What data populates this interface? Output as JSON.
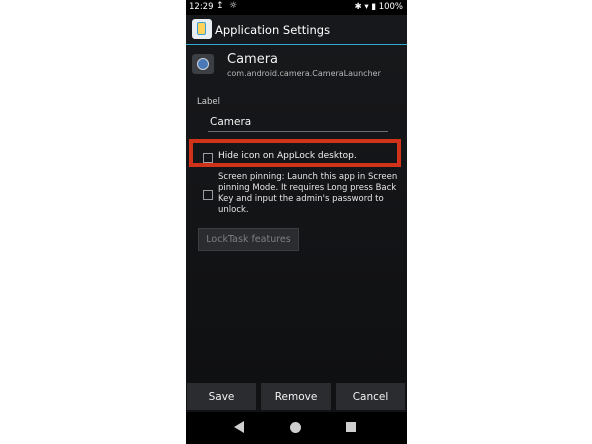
{
  "status_bar": {
    "time": "12:29",
    "upload_icon": "↥",
    "sun_icon": "☼",
    "right": "✱ ▾ ▮ 100%"
  },
  "titlebar": {
    "title": "Application Settings"
  },
  "app": {
    "name": "Camera",
    "package": "com.android.camera.CameraLauncher"
  },
  "label_field": {
    "label": "Label",
    "value": "Camera"
  },
  "options": {
    "hide_icon": {
      "label": "Hide icon on AppLock desktop.",
      "checked": false
    },
    "screen_pinning": {
      "label": "Screen pinning: Launch this app in Screen pinning Mode. It requires Long press Back Key and input the admin's password to unlock.",
      "checked": false
    }
  },
  "locktask_button": "LockTask features",
  "buttons": {
    "save": "Save",
    "remove": "Remove",
    "cancel": "Cancel"
  },
  "colors": {
    "highlight": "#d03319",
    "accent_line": "#2fa8d6"
  }
}
